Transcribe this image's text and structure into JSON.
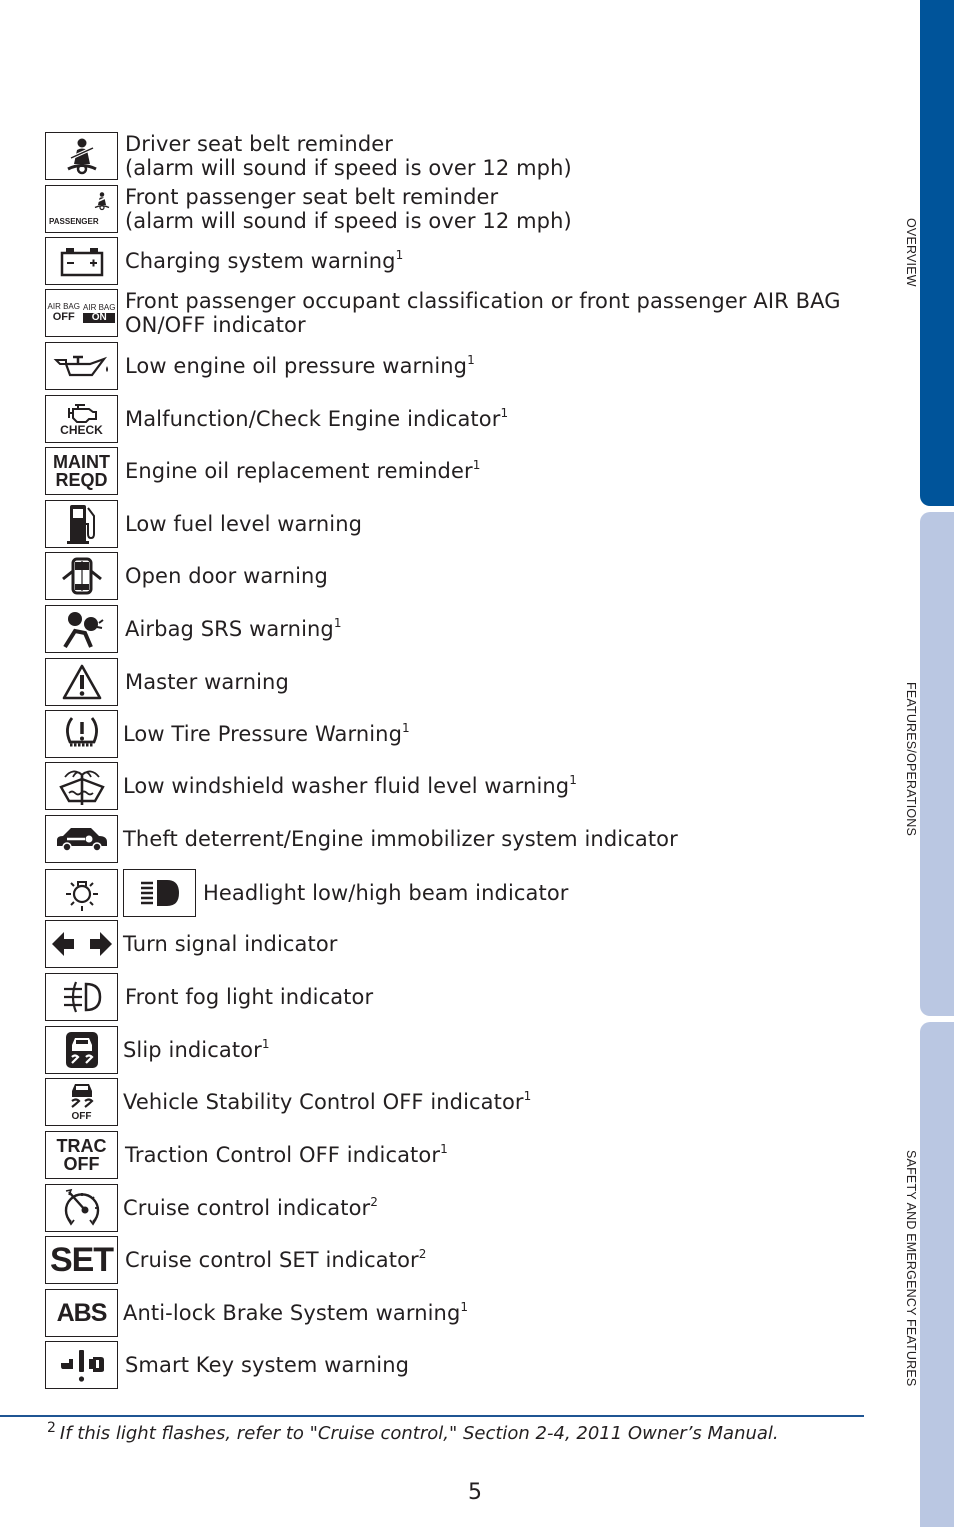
{
  "indicators": [
    {
      "icon": "driver-seat-belt-icon",
      "line1": "Driver seat belt reminder",
      "line2": "(alarm will sound if speed is over 12 mph)",
      "sup": ""
    },
    {
      "icon": "passenger-seat-belt-icon",
      "icon_text": "PASSENGER",
      "line1": "Front passenger seat belt reminder",
      "line2": "(alarm will sound if speed is over 12 mph)",
      "sup": ""
    },
    {
      "icon": "battery-icon",
      "line1": "Charging system warning",
      "sup": "1"
    },
    {
      "icon": "airbag-on-off-icon",
      "icon_text_a": "AIR BAG",
      "icon_text_b": "OFF",
      "icon_text_c": "AIR BAG",
      "icon_text_d": "ON",
      "line1": "Front passenger occupant classification or front passenger AIR BAG",
      "line2": "ON/OFF indicator",
      "sup": ""
    },
    {
      "icon": "oil-can-icon",
      "line1": "Low engine oil pressure warning",
      "sup": "1"
    },
    {
      "icon": "check-engine-icon",
      "icon_text": "CHECK",
      "line1": "Malfunction/Check Engine indicator",
      "sup": "1"
    },
    {
      "icon": "maint-reqd-icon",
      "icon_text_a": "MAINT",
      "icon_text_b": "REQD",
      "line1": "Engine oil replacement reminder",
      "sup": "1"
    },
    {
      "icon": "fuel-pump-icon",
      "line1": "Low fuel level warning",
      "sup": ""
    },
    {
      "icon": "open-door-icon",
      "line1": "Open door warning",
      "sup": ""
    },
    {
      "icon": "airbag-srs-icon",
      "line1": "Airbag SRS warning",
      "sup": "1"
    },
    {
      "icon": "master-warning-icon",
      "line1": "Master warning",
      "sup": ""
    },
    {
      "icon": "tire-pressure-icon",
      "line1": "Low Tire Pressure Warning",
      "sup": "1"
    },
    {
      "icon": "washer-fluid-icon",
      "line1": "Low windshield washer fluid level warning",
      "sup": "1"
    },
    {
      "icon": "theft-deterrent-icon",
      "line1": "Theft deterrent/Engine immobilizer system indicator",
      "sup": ""
    },
    {
      "icon": "headlight-icon",
      "line1": "Headlight low/high beam indicator",
      "sup": ""
    },
    {
      "icon": "turn-signal-icon",
      "line1": "Turn signal indicator",
      "sup": ""
    },
    {
      "icon": "fog-light-icon",
      "line1": "Front fog light indicator",
      "sup": ""
    },
    {
      "icon": "slip-icon",
      "line1": "Slip indicator",
      "sup": "1"
    },
    {
      "icon": "vsc-off-icon",
      "icon_text": "OFF",
      "line1": "Vehicle Stability Control OFF indicator",
      "sup": "1"
    },
    {
      "icon": "trac-off-icon",
      "icon_text_a": "TRAC",
      "icon_text_b": "OFF",
      "line1": "Traction Control OFF indicator",
      "sup": "1"
    },
    {
      "icon": "cruise-control-icon",
      "line1": "Cruise control indicator",
      "sup": "2"
    },
    {
      "icon": "set-icon",
      "icon_text": "SET",
      "line1": "Cruise control SET indicator",
      "sup": "2"
    },
    {
      "icon": "abs-icon",
      "icon_text": "ABS",
      "line1": "Anti-lock Brake System warning",
      "sup": "1"
    },
    {
      "icon": "smart-key-icon",
      "line1": "Smart Key system warning",
      "sup": ""
    }
  ],
  "footnote": {
    "number": "2",
    "text": "If this light flashes, refer to \"Cruise control,\" Section 2-4, 2011 Owner’s Manual."
  },
  "page_number": "5",
  "side_tabs": [
    {
      "label": "OVERVIEW",
      "active": true,
      "color": "#00549a"
    },
    {
      "label": "FEATURES/OPERATIONS",
      "active": false,
      "color": "#bac7e2"
    },
    {
      "label": "SAFETY AND EMERGENCY FEATURES",
      "active": false,
      "color": "#bac7e2"
    }
  ]
}
